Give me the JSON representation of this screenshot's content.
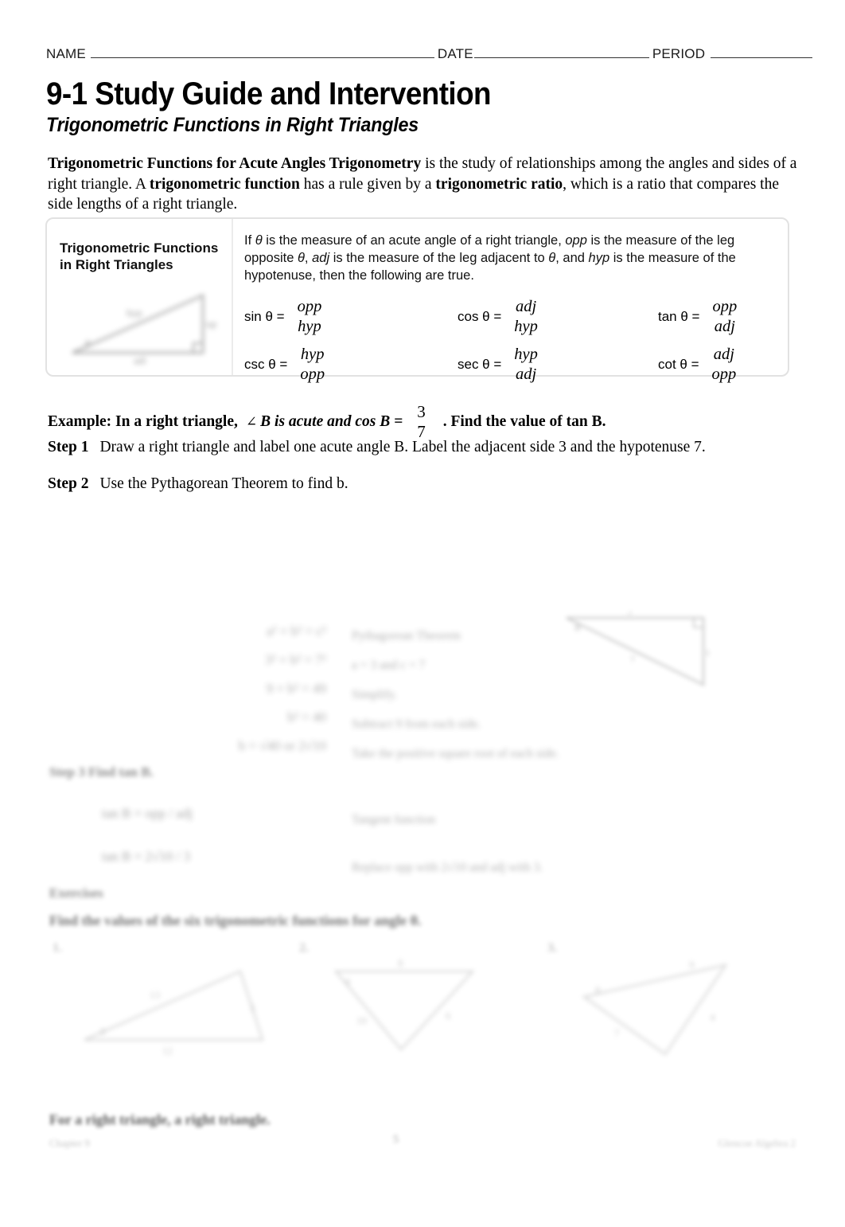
{
  "header": {
    "name_label": "NAME",
    "date_label": "DATE",
    "period_label": "PERIOD"
  },
  "title": {
    "main": "9-1 Study Guide and Intervention",
    "subtitle": "Trigonometric Functions in Right Triangles"
  },
  "intro": {
    "lead_bold": "Trigonometric Functions for Acute Angles Trigonometry",
    "part1": " is the study of relationships among the angles and sides of a right triangle. A ",
    "bold1": "trigonometric function",
    "part2": " has a rule given by a ",
    "bold2": "trigonometric ratio",
    "part3": ", which is a ratio that compares the side lengths of a right triangle."
  },
  "concept_box": {
    "label_line1": "Trigonometric Functions",
    "label_line2": "in Right Triangles",
    "figure_alt": "right-triangle-diagram",
    "description_p1": "If ",
    "theta": "θ",
    "description_p2": " is the measure of an acute angle of a right triangle, ",
    "opp": "opp",
    "description_p3": " is the measure of the leg opposite ",
    "description_p4": ", ",
    "adj": "adj",
    "description_p5": " is the measure of the leg adjacent to ",
    "description_p6": ", and ",
    "hyp": "hyp",
    "description_p7": " is the measure of the hypotenuse, then the following are true.",
    "ratios": [
      {
        "name": "sin",
        "label": "sin θ =",
        "numerator": "opp",
        "denominator": "hyp"
      },
      {
        "name": "cos",
        "label": "cos θ =",
        "numerator": "adj",
        "denominator": "hyp"
      },
      {
        "name": "tan",
        "label": "tan θ =",
        "numerator": "opp",
        "denominator": "adj"
      },
      {
        "name": "csc",
        "label": "csc θ =",
        "numerator": "hyp",
        "denominator": "opp"
      },
      {
        "name": "sec",
        "label": "sec θ =",
        "numerator": "hyp",
        "denominator": "adj"
      },
      {
        "name": "cot",
        "label": "cot θ =",
        "numerator": "adj",
        "denominator": "opp"
      }
    ]
  },
  "example": {
    "lead": "Example:",
    "text_before": "In a right triangle,",
    "angle_symbol": "∠",
    "text_mid": "B is acute and cos B =",
    "fraction_numerator": "3",
    "fraction_denominator": "7",
    "text_after": ". Find the value of tan B."
  },
  "steps": [
    {
      "label": "Step 1",
      "text": "Draw a right triangle and label one acute angle B. Label the adjacent side 3 and the hypotenuse 7."
    },
    {
      "label": "Step 2",
      "text": "Use the Pythagorean Theorem to find b."
    }
  ],
  "blurred": {
    "note": "illegible-blurred-region",
    "work_equations": [
      "a² + b² = c²",
      "3² + b² = 7²",
      "9 + b² = 49",
      "b² = 40",
      "b = √40 or 2√10"
    ],
    "work_notes": [
      "Pythagorean Theorem",
      "a = 3 and c = 7",
      "Simplify.",
      "Subtract 9 from each side.",
      "Take the positive square root of each side."
    ],
    "step3_label": "Step 3  Find tan B.",
    "work_equations2": [
      "tan B = opp / adj",
      "tan B = 2√10 / 3"
    ],
    "work_notes2": [
      "Tangent function",
      "Replace opp with 2√10 and adj with 3."
    ],
    "exercises_label": "Exercises",
    "exercises_directions": "Find the values of the six trigonometric functions for angle θ.",
    "exercise_numbers": [
      "1.",
      "2.",
      "3."
    ],
    "answer_line": "For a right triangle, a right triangle.",
    "footer_left": "Chapter 9",
    "footer_center": "5",
    "footer_right": "Glencoe Algebra 2"
  }
}
